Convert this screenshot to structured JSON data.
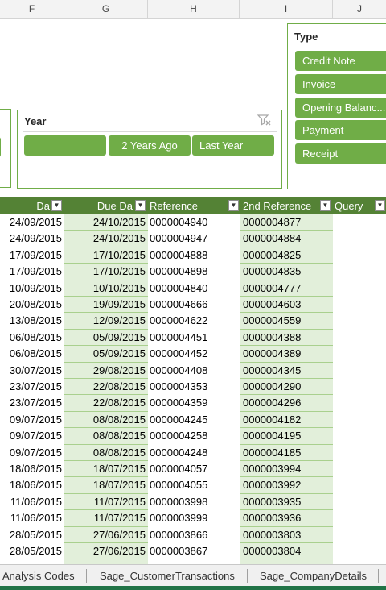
{
  "column_headers": [
    "F",
    "G",
    "H",
    "I",
    "J"
  ],
  "year_slicer": {
    "title": "Year",
    "buttons": [
      "",
      "2 Years Ago",
      "Last Year"
    ]
  },
  "type_slicer": {
    "title": "Type",
    "buttons": [
      "Credit Note",
      "Invoice",
      "Opening Balanc...",
      "Payment",
      "Receipt"
    ]
  },
  "table": {
    "headers": [
      "Da",
      "Due Da",
      "Reference",
      "2nd Reference",
      "Query"
    ],
    "rows": [
      [
        "24/09/2015",
        "24/10/2015",
        "0000004940",
        "0000004877"
      ],
      [
        "24/09/2015",
        "24/10/2015",
        "0000004947",
        "0000004884"
      ],
      [
        "17/09/2015",
        "17/10/2015",
        "0000004888",
        "0000004825"
      ],
      [
        "17/09/2015",
        "17/10/2015",
        "0000004898",
        "0000004835"
      ],
      [
        "10/09/2015",
        "10/10/2015",
        "0000004840",
        "0000004777"
      ],
      [
        "20/08/2015",
        "19/09/2015",
        "0000004666",
        "0000004603"
      ],
      [
        "13/08/2015",
        "12/09/2015",
        "0000004622",
        "0000004559"
      ],
      [
        "06/08/2015",
        "05/09/2015",
        "0000004451",
        "0000004388"
      ],
      [
        "06/08/2015",
        "05/09/2015",
        "0000004452",
        "0000004389"
      ],
      [
        "30/07/2015",
        "29/08/2015",
        "0000004408",
        "0000004345"
      ],
      [
        "23/07/2015",
        "22/08/2015",
        "0000004353",
        "0000004290"
      ],
      [
        "23/07/2015",
        "22/08/2015",
        "0000004359",
        "0000004296"
      ],
      [
        "09/07/2015",
        "08/08/2015",
        "0000004245",
        "0000004182"
      ],
      [
        "09/07/2015",
        "08/08/2015",
        "0000004258",
        "0000004195"
      ],
      [
        "09/07/2015",
        "08/08/2015",
        "0000004248",
        "0000004185"
      ],
      [
        "18/06/2015",
        "18/07/2015",
        "0000004057",
        "0000003994"
      ],
      [
        "18/06/2015",
        "18/07/2015",
        "0000004055",
        "0000003992"
      ],
      [
        "11/06/2015",
        "11/07/2015",
        "0000003998",
        "0000003935"
      ],
      [
        "11/06/2015",
        "11/07/2015",
        "0000003999",
        "0000003936"
      ],
      [
        "28/05/2015",
        "27/06/2015",
        "0000003866",
        "0000003803"
      ],
      [
        "28/05/2015",
        "27/06/2015",
        "0000003867",
        "0000003804"
      ]
    ]
  },
  "sheet_tabs": [
    "Analysis Codes",
    "Sage_CustomerTransactions",
    "Sage_CompanyDetails"
  ],
  "icons": {
    "clear_filter": "clear-filter-icon",
    "dropdown": "dropdown-arrow-icon"
  },
  "colors": {
    "accent": "#70ad47",
    "header": "#548235",
    "band": "#e2efda",
    "status": "#217346"
  }
}
